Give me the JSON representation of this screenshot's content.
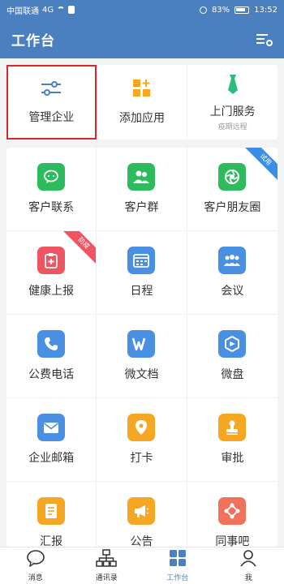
{
  "status_bar": {
    "carrier": "中国联通",
    "signal": "4G",
    "battery": "83%",
    "time": "13:52"
  },
  "app_bar": {
    "title": "工作台"
  },
  "shortcuts": [
    {
      "label": "管理企业",
      "sub": "",
      "icon": "sliders-icon",
      "highlighted": true
    },
    {
      "label": "添加应用",
      "sub": "",
      "icon": "add-app-icon",
      "highlighted": false
    },
    {
      "label": "上门服务",
      "sub": "疫期远程",
      "icon": "tie-icon",
      "highlighted": false
    }
  ],
  "apps": [
    {
      "label": "客户联系",
      "icon": "chat-bubble-icon",
      "color": "#2dbb5d",
      "badge": ""
    },
    {
      "label": "客户群",
      "icon": "group-icon",
      "color": "#2dbb5d",
      "badge": ""
    },
    {
      "label": "客户朋友圈",
      "icon": "aperture-icon",
      "color": "#2dbb5d",
      "badge": "试用"
    },
    {
      "label": "健康上报",
      "icon": "clipboard-plus-icon",
      "color": "#ef5461",
      "badge": "防疫"
    },
    {
      "label": "日程",
      "icon": "calendar-icon",
      "color": "#4a90e2",
      "badge": ""
    },
    {
      "label": "会议",
      "icon": "meeting-icon",
      "color": "#4a90e2",
      "badge": ""
    },
    {
      "label": "公费电话",
      "icon": "phone-icon",
      "color": "#4a90e2",
      "badge": ""
    },
    {
      "label": "微文档",
      "icon": "doc-w-icon",
      "color": "#4a90e2",
      "badge": ""
    },
    {
      "label": "微盘",
      "icon": "drive-icon",
      "color": "#4a90e2",
      "badge": ""
    },
    {
      "label": "企业邮箱",
      "icon": "mail-icon",
      "color": "#4a90e2",
      "badge": ""
    },
    {
      "label": "打卡",
      "icon": "location-pin-icon",
      "color": "#f5a623",
      "badge": ""
    },
    {
      "label": "审批",
      "icon": "stamp-icon",
      "color": "#f5a623",
      "badge": ""
    },
    {
      "label": "汇报",
      "icon": "report-icon",
      "color": "#f5a623",
      "badge": ""
    },
    {
      "label": "公告",
      "icon": "megaphone-icon",
      "color": "#f5a623",
      "badge": ""
    },
    {
      "label": "同事吧",
      "icon": "network-icon",
      "color": "#f0725b",
      "badge": ""
    }
  ],
  "bottom_nav": [
    {
      "label": "消息",
      "icon": "message-icon",
      "active": false
    },
    {
      "label": "通讯录",
      "icon": "contacts-tree-icon",
      "active": false
    },
    {
      "label": "工作台",
      "icon": "workbench-grid-icon",
      "active": true
    },
    {
      "label": "我",
      "icon": "person-icon",
      "active": false
    }
  ],
  "colors": {
    "primary": "#4a7fc0",
    "green_ribbon": "#3a8ee6",
    "red_ribbon": "#ef5461",
    "highlight_border": "#d9252b"
  }
}
